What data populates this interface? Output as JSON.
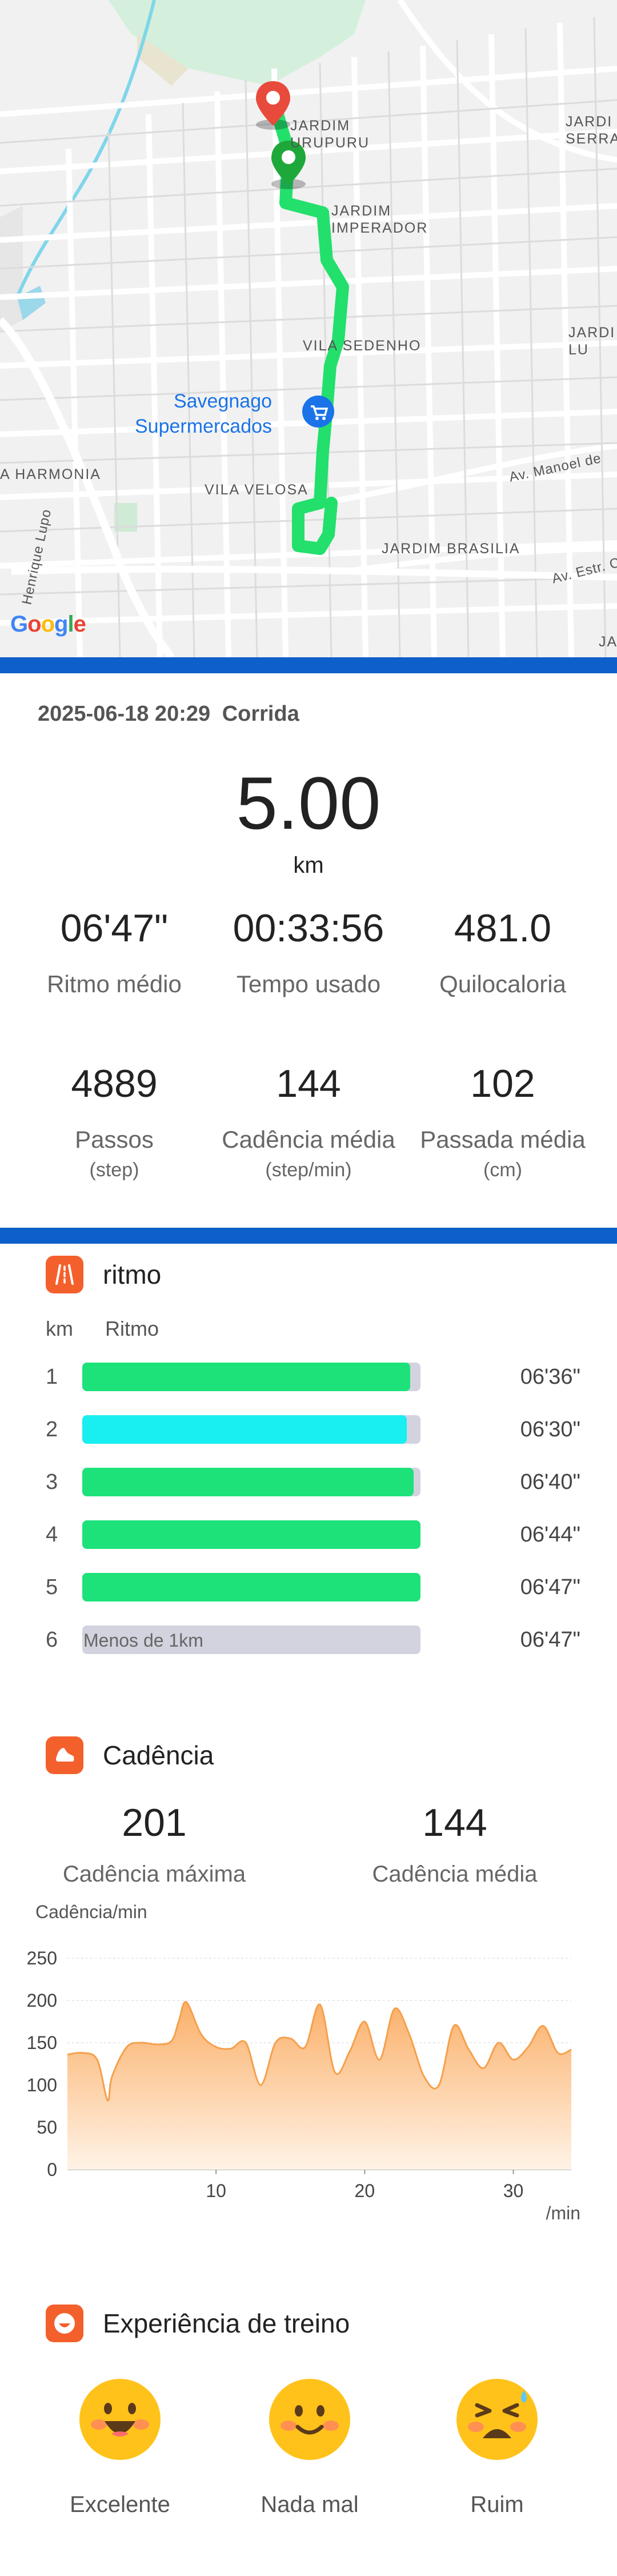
{
  "map": {
    "labels": [
      {
        "id": "jardim-urupuru",
        "text": "JARDIM\nURUPURU"
      },
      {
        "id": "jardim-serra",
        "text": "JARDI\nSERRA A"
      },
      {
        "id": "jardim-imperador",
        "text": "JARDIM\nIMPERADOR"
      },
      {
        "id": "jardim-lu",
        "text": "JARDI\nLU"
      },
      {
        "id": "vila-sedenho",
        "text": "VILA SEDENHO"
      },
      {
        "id": "harmonia",
        "text": "A HARMONIA"
      },
      {
        "id": "vila-velosa",
        "text": "VILA VELOSA"
      },
      {
        "id": "jardim-brasilia",
        "text": "JARDIM BRASILIA"
      },
      {
        "id": "ja",
        "text": "JA"
      }
    ],
    "streets": {
      "manoel": "Av. Manoel de",
      "estr": "Av. Estr. C",
      "henrique": "Henrique Lupo"
    },
    "poi": "Savegnago\nSupermercados",
    "attribution": "Google",
    "route_color": "#22e06b",
    "start_color": "#1fa83a",
    "end_color": "#e84b3c"
  },
  "summary": {
    "date": "2025-06-18 20:29",
    "activity": "Corrida",
    "distance": "5.00",
    "distance_unit": "km",
    "stats_row1": [
      {
        "value": "06'47\"",
        "label": "Ritmo médio"
      },
      {
        "value": "00:33:56",
        "label": "Tempo usado"
      },
      {
        "value": "481.0",
        "label": "Quilocaloria"
      }
    ],
    "stats_row2": [
      {
        "value": "4889",
        "label": "Passos",
        "unit": "(step)"
      },
      {
        "value": "144",
        "label": "Cadência média",
        "unit": "(step/min)"
      },
      {
        "value": "102",
        "label": "Passada média",
        "unit": "(cm)"
      }
    ]
  },
  "pace": {
    "title": "ritmo",
    "col_km": "km",
    "col_pace": "Ritmo",
    "rows": [
      {
        "km": "1",
        "time": "06'36\"",
        "fraction": 0.97,
        "color": "#1de27a",
        "note": ""
      },
      {
        "km": "2",
        "time": "06'30\"",
        "fraction": 0.96,
        "color": "#19eef0",
        "note": ""
      },
      {
        "km": "3",
        "time": "06'40\"",
        "fraction": 0.98,
        "color": "#1de27a",
        "note": ""
      },
      {
        "km": "4",
        "time": "06'44\"",
        "fraction": 1.0,
        "color": "#1de27a",
        "note": ""
      },
      {
        "km": "5",
        "time": "06'47\"",
        "fraction": 1.0,
        "color": "#1de27a",
        "note": ""
      },
      {
        "km": "6",
        "time": "06'47\"",
        "fraction": 0.0,
        "color": "#d3d3df",
        "note": "Menos de 1km"
      }
    ]
  },
  "cadence": {
    "title": "Cadência",
    "max_value": "201",
    "max_label": "Cadência máxima",
    "avg_value": "144",
    "avg_label": "Cadência média"
  },
  "chart_data": {
    "type": "area",
    "ylabel": "Cadência/min",
    "xlabel": "/min",
    "ylim": [
      0,
      250
    ],
    "yticks": [
      "250",
      "200",
      "150",
      "100",
      "50",
      "0"
    ],
    "xlim": [
      0,
      33.9
    ],
    "xticks": [
      "10",
      "20",
      "30"
    ],
    "x": [
      0,
      1,
      2,
      2.7,
      3,
      4,
      5,
      6,
      7,
      7.5,
      8,
      9,
      10,
      11,
      12,
      13,
      14,
      15,
      16,
      17,
      18,
      19,
      20,
      21,
      22,
      23,
      24,
      25,
      26,
      27,
      28,
      29,
      30,
      31,
      32,
      33,
      33.9
    ],
    "y": [
      136,
      138,
      130,
      82,
      110,
      145,
      150,
      148,
      152,
      176,
      198,
      160,
      145,
      143,
      150,
      100,
      150,
      155,
      145,
      195,
      115,
      140,
      175,
      130,
      190,
      160,
      110,
      100,
      170,
      142,
      120,
      150,
      130,
      145,
      170,
      138,
      142
    ],
    "colors": {
      "line": "#f5a04c",
      "fill_top": "#fbb06a",
      "fill_bottom": "#fff3e6"
    }
  },
  "experience": {
    "title": "Experiência de treino",
    "options": [
      {
        "label": "Excelente",
        "icon": "grinning-face-icon"
      },
      {
        "label": "Nada mal",
        "icon": "smiling-face-icon"
      },
      {
        "label": "Ruim",
        "icon": "tired-face-icon"
      }
    ]
  }
}
